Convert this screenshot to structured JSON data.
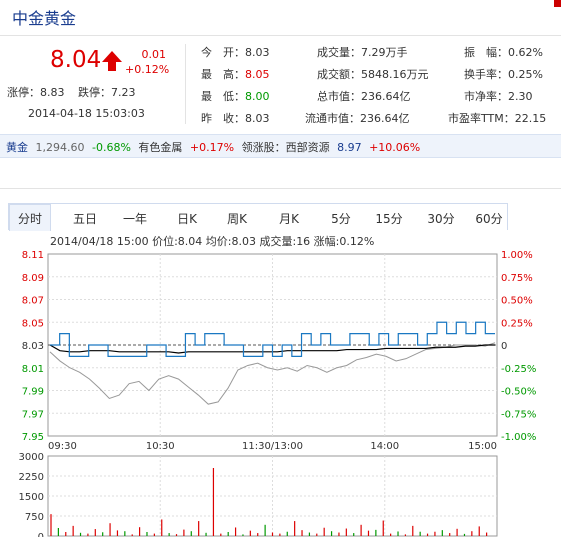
{
  "header": {
    "stock_name": "中金黄金"
  },
  "price": {
    "last": "8.04",
    "change": "0.01",
    "change_pct": "+0.12%",
    "limit_up_label": "涨停：",
    "limit_up": "8.83",
    "limit_down_label": "跌停：",
    "limit_down": "7.23",
    "timestamp": "2014-04-18 15:03:03"
  },
  "quote": {
    "open_label": "今　开：",
    "open": "8.03",
    "high_label": "最　高：",
    "high": "8.05",
    "low_label": "最　低：",
    "low": "8.00",
    "prev_label": "昨　收：",
    "prev": "8.03",
    "vol_label": "成交量：",
    "vol": "7.29万手",
    "amt_label": "成交额：",
    "amt": "5848.16万元",
    "mcap_label": "总市值：",
    "mcap": "236.64亿",
    "fcap_label": "流通市值：",
    "fcap": "236.64亿",
    "amp_label": "振　幅：",
    "amp": "0.62%",
    "turn_label": "换手率：",
    "turn": "0.25%",
    "pb_label": "市净率：",
    "pb": "2.30",
    "pe_label": "市盈率TTM：",
    "pe": "22.15"
  },
  "market": {
    "gold_label": "黄金",
    "gold_price": "1,294.60",
    "gold_chg": "-0.68%",
    "sector_label": "有色金属",
    "sector_chg": "+0.17%",
    "leader_label": "领涨股：",
    "leader_name": "西部资源",
    "leader_price": "8.97",
    "leader_chg": "+10.06%"
  },
  "tabs": [
    "分时",
    "五日",
    "一年",
    "日K",
    "周K",
    "月K",
    "5分",
    "15分",
    "30分",
    "60分"
  ],
  "colors": {
    "up": "#dd0000",
    "down": "#009900",
    "price_line": "#1a78c2",
    "avg_line": "#000000",
    "prev_line": "#999999"
  },
  "chart_data": [
    {
      "type": "line",
      "info_line": "2014/04/18 15:00  价位:8.04  均价:8.03  成交量:16  涨幅:0.12%",
      "y_ticks_left": [
        "8.11",
        "8.09",
        "8.07",
        "8.05",
        "8.03",
        "8.01",
        "7.99",
        "7.97",
        "7.95"
      ],
      "y_ticks_right": [
        "1.00%",
        "0.75%",
        "0.50%",
        "0.25%",
        "0",
        "-0.25%",
        "-0.50%",
        "-0.75%",
        "-1.00%"
      ],
      "x_ticks": [
        "09:30",
        "10:30",
        "11:30/13:00",
        "14:00",
        "15:00"
      ],
      "ylim": [
        7.95,
        8.11
      ],
      "prev_close": 8.03,
      "series": [
        {
          "name": "价位",
          "values": [
            8.03,
            8.04,
            8.02,
            8.02,
            8.03,
            8.03,
            8.02,
            8.02,
            8.02,
            8.02,
            8.03,
            8.03,
            8.02,
            8.02,
            8.04,
            8.03,
            8.04,
            8.04,
            8.03,
            8.03,
            8.02,
            8.02,
            8.03,
            8.02,
            8.03,
            8.02,
            8.04,
            8.03,
            8.04,
            8.03,
            8.03,
            8.04,
            8.04,
            8.03,
            8.04,
            8.03,
            8.04,
            8.04,
            8.03,
            8.04,
            8.05,
            8.04,
            8.05,
            8.04,
            8.05,
            8.04
          ]
        },
        {
          "name": "均价",
          "values": [
            8.03,
            8.025,
            8.024,
            8.024,
            8.025,
            8.025,
            8.025,
            8.024,
            8.024,
            8.024,
            8.024,
            8.024,
            8.024,
            8.023,
            8.024,
            8.024,
            8.024,
            8.024,
            8.024,
            8.024,
            8.024,
            8.024,
            8.024,
            8.024,
            8.025,
            8.025,
            8.025,
            8.025,
            8.025,
            8.025,
            8.026,
            8.026,
            8.026,
            8.026,
            8.027,
            8.027,
            8.027,
            8.027,
            8.027,
            8.028,
            8.028,
            8.028,
            8.029,
            8.029,
            8.03,
            8.03
          ]
        },
        {
          "name": "大盘",
          "values": [
            8.024,
            8.016,
            8.01,
            8.006,
            8.0,
            7.992,
            7.983,
            7.986,
            7.996,
            7.998,
            7.99,
            8.0,
            8.003,
            8.0,
            7.993,
            7.986,
            7.978,
            7.98,
            7.992,
            8.008,
            8.012,
            8.014,
            8.01,
            8.008,
            8.01,
            8.007,
            8.012,
            8.01,
            8.006,
            8.01,
            8.012,
            8.017,
            8.019,
            8.022,
            8.02,
            8.016,
            8.018,
            8.022,
            8.026,
            8.027,
            8.028,
            8.03,
            8.03,
            8.03,
            8.029,
            8.032
          ]
        }
      ]
    },
    {
      "type": "bar",
      "y_ticks": [
        "3000",
        "2250",
        "1500",
        "750",
        "0"
      ],
      "ylim": [
        0,
        3000
      ],
      "values": [
        820,
        300,
        150,
        380,
        120,
        90,
        260,
        140,
        480,
        210,
        180,
        60,
        330,
        150,
        90,
        620,
        110,
        70,
        240,
        180,
        560,
        120,
        2550,
        90,
        150,
        320,
        60,
        200,
        110,
        420,
        130,
        90,
        160,
        560,
        220,
        130,
        90,
        310,
        180,
        130,
        280,
        110,
        420,
        200,
        230,
        580,
        90,
        170,
        60,
        380,
        160,
        90,
        160,
        220,
        110,
        270,
        80,
        180,
        360,
        130
      ],
      "up": [
        1,
        0,
        1,
        1,
        0,
        1,
        1,
        0,
        1,
        1,
        0,
        1,
        1,
        0,
        1,
        1,
        0,
        1,
        1,
        0,
        1,
        0,
        1,
        1,
        0,
        1,
        0,
        1,
        1,
        0,
        1,
        1,
        0,
        1,
        1,
        0,
        1,
        1,
        0,
        1,
        1,
        0,
        1,
        1,
        0,
        1,
        1,
        0,
        1,
        1,
        0,
        1,
        1,
        0,
        1,
        1,
        0,
        1,
        1,
        1
      ]
    }
  ]
}
